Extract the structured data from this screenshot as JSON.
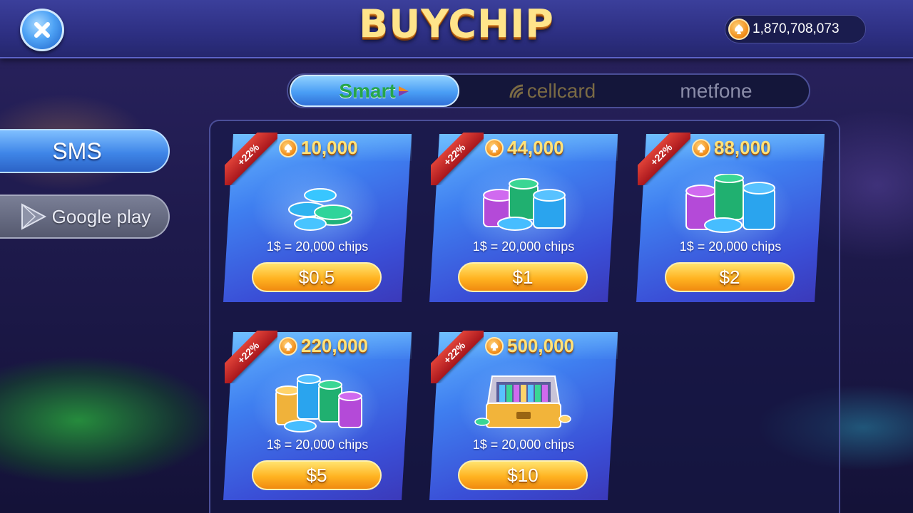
{
  "header": {
    "title": "BUYCHIP",
    "balance": "1,870,708,073"
  },
  "providers": [
    {
      "label": "Smart",
      "selected": true
    },
    {
      "label": "cellcard",
      "selected": false
    },
    {
      "label": "metfone",
      "selected": false
    }
  ],
  "side_menu": {
    "sms_label": "SMS",
    "google_label": "Google play"
  },
  "packages": [
    {
      "bonus": "+22%",
      "chips": "10,000",
      "rate": "1$ = 20,000 chips",
      "price": "$0.5"
    },
    {
      "bonus": "+22%",
      "chips": "44,000",
      "rate": "1$ = 20,000 chips",
      "price": "$1"
    },
    {
      "bonus": "+22%",
      "chips": "88,000",
      "rate": "1$ = 20,000 chips",
      "price": "$2"
    },
    {
      "bonus": "+22%",
      "chips": "220,000",
      "rate": "1$ = 20,000 chips",
      "price": "$5"
    },
    {
      "bonus": "+22%",
      "chips": "500,000",
      "rate": "1$ = 20,000 chips",
      "price": "$10"
    }
  ],
  "colors": {
    "accent_blue": "#3f86e8",
    "gold": "#ffe27a",
    "ribbon_red": "#d12a2a",
    "smart_green": "#26a64a"
  }
}
